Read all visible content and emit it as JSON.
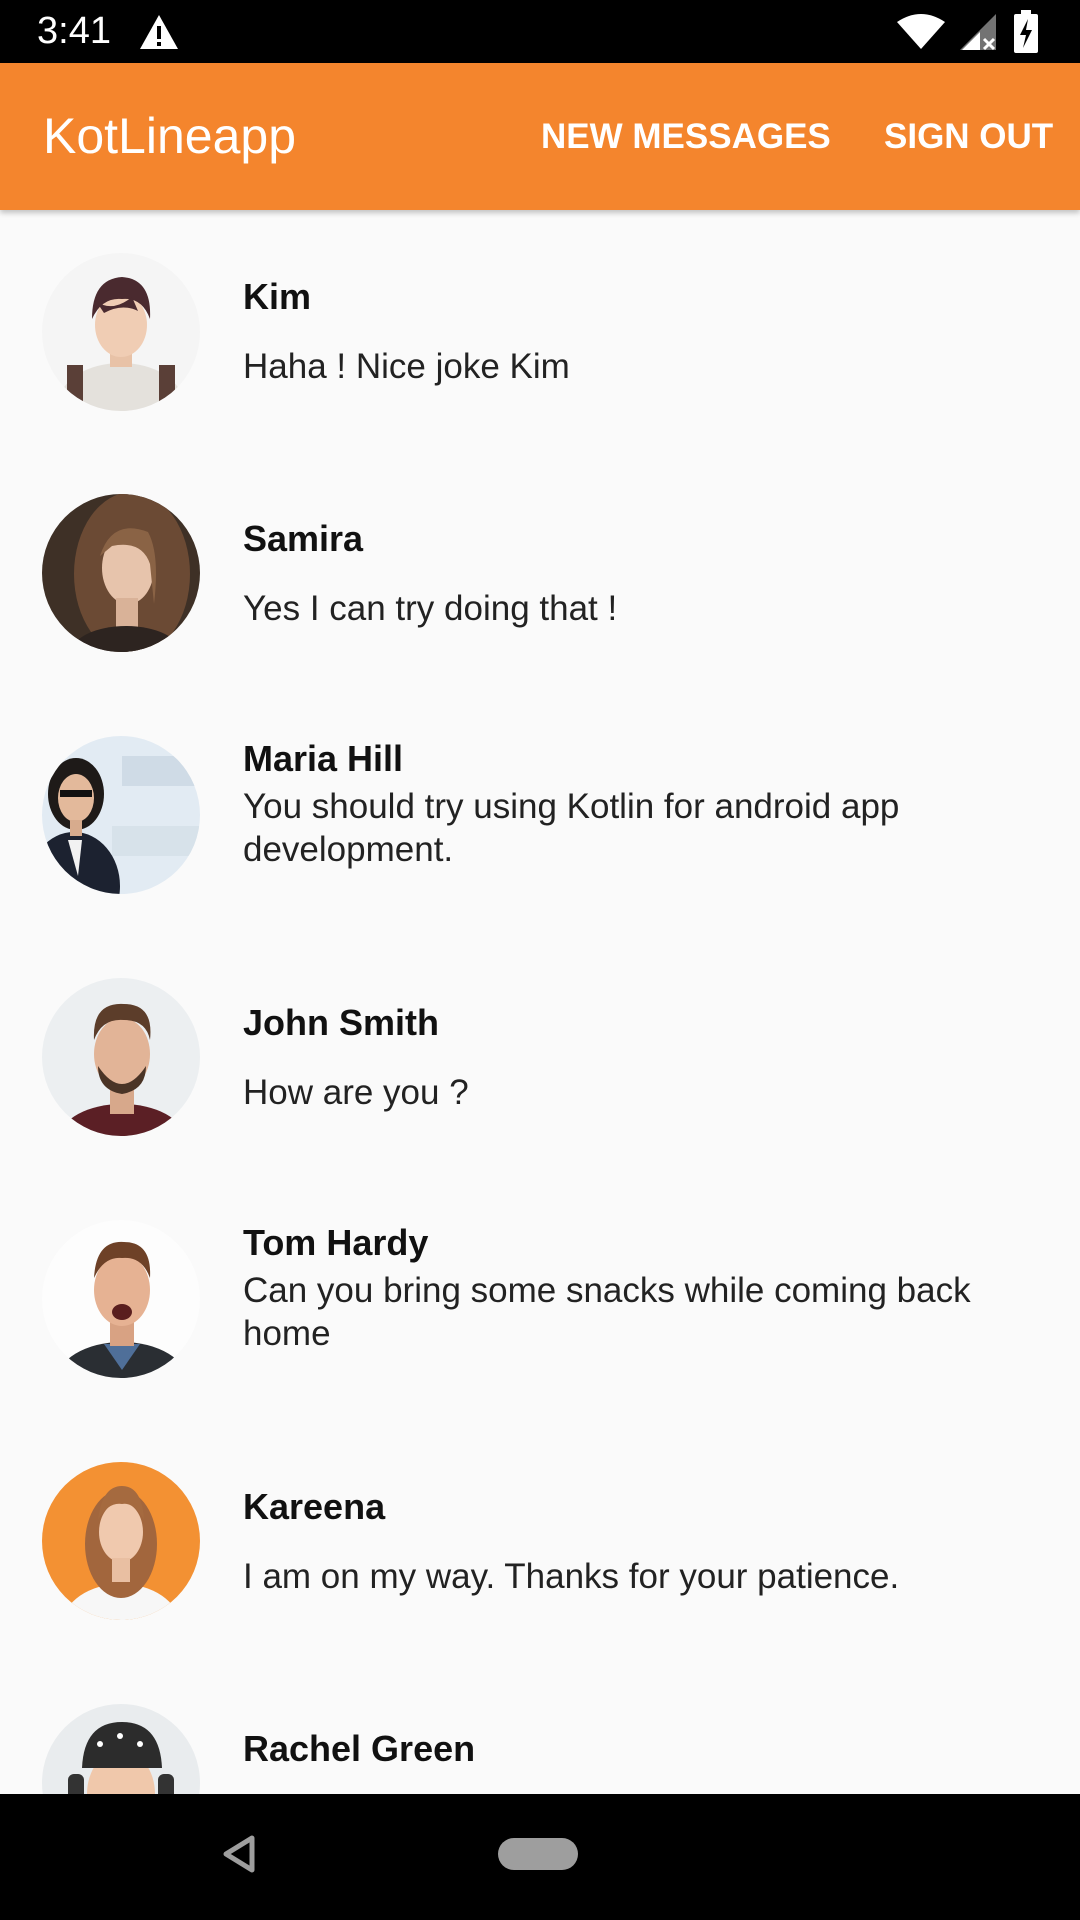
{
  "status_bar": {
    "time": "3:41",
    "icons": [
      "warning-icon",
      "wifi-icon",
      "signal-icon",
      "battery-charging-icon"
    ]
  },
  "app_bar": {
    "title": "KotLineapp",
    "color": "#f4852d",
    "actions": {
      "new_messages": "NEW MESSAGES",
      "sign_out": "SIGN OUT"
    }
  },
  "conversations": [
    {
      "name": "Kim",
      "message": "Haha ! Nice joke Kim",
      "avatar": "kim-avatar"
    },
    {
      "name": "Samira",
      "message": "Yes I can try doing that !",
      "avatar": "samira-avatar"
    },
    {
      "name": "Maria Hill",
      "message": "You should try using Kotlin for android app development.",
      "avatar": "maria-hill-avatar"
    },
    {
      "name": "John Smith",
      "message": "How are you ?",
      "avatar": "john-smith-avatar"
    },
    {
      "name": "Tom Hardy",
      "message": "Can you bring some snacks while coming back home",
      "avatar": "tom-hardy-avatar"
    },
    {
      "name": "Kareena",
      "message": "I am on my way. Thanks for your patience.",
      "avatar": "kareena-avatar"
    },
    {
      "name": "Rachel Green",
      "message": "",
      "avatar": "rachel-green-avatar"
    }
  ],
  "nav_bar": {
    "icons": [
      "back-icon",
      "home-icon"
    ]
  }
}
